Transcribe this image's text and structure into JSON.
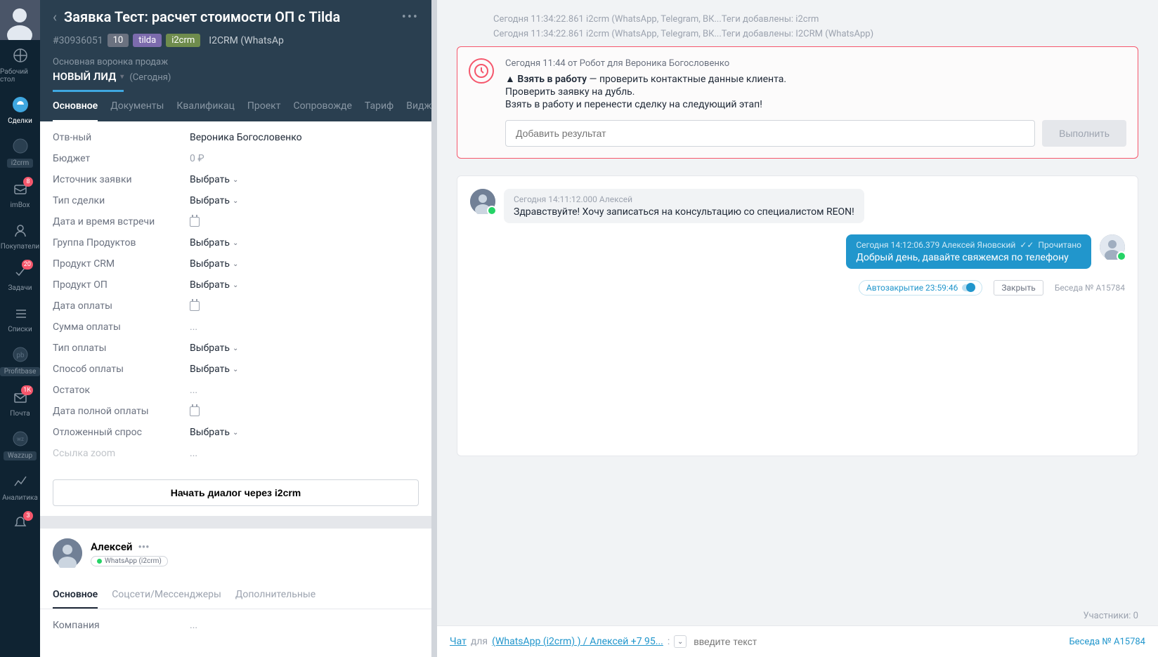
{
  "nav": {
    "items": [
      {
        "label": "Рабочий стол"
      },
      {
        "label": "Сделки"
      },
      {
        "label": "i2crm"
      },
      {
        "label": "imBox",
        "badge": "8"
      },
      {
        "label": "Покупатели"
      },
      {
        "label": "Задачи",
        "badge": "20"
      },
      {
        "label": "Списки"
      },
      {
        "label": "Profitbase"
      },
      {
        "label": "Почта",
        "badge": "1K"
      },
      {
        "label": "Wazzup"
      },
      {
        "label": "Аналитика"
      },
      {
        "label": "",
        "badge": "3"
      }
    ]
  },
  "deal": {
    "title": "Заявка Тест: расчет стоимости ОП с Tilda",
    "id": "#30936051",
    "tags": [
      "10",
      "tilda",
      "i2crm"
    ],
    "source": "I2CRM (WhatsAp",
    "funnel": "Основная воронка продаж",
    "status": "НОВЫЙ ЛИД",
    "status_date": "(Сегодня)"
  },
  "tabs": [
    "Основное",
    "Документы",
    "Квалификац",
    "Проект",
    "Сопровожде",
    "Тариф",
    "Виджеты"
  ],
  "fields": {
    "responsible": {
      "label": "Отв-ный",
      "value": "Вероника Богословенко"
    },
    "budget": {
      "label": "Бюджет",
      "value": "0 ₽"
    },
    "lead_source": {
      "label": "Источник заявки",
      "value": "Выбрать"
    },
    "deal_type": {
      "label": "Тип сделки",
      "value": "Выбрать"
    },
    "meeting_date": {
      "label": "Дата и время встречи"
    },
    "product_group": {
      "label": "Группа Продуктов",
      "value": "Выбрать"
    },
    "product_crm": {
      "label": "Продукт CRM",
      "value": "Выбрать"
    },
    "product_op": {
      "label": "Продукт ОП",
      "value": "Выбрать"
    },
    "payment_date": {
      "label": "Дата оплаты"
    },
    "payment_sum": {
      "label": "Сумма оплаты",
      "value": "..."
    },
    "payment_type": {
      "label": "Тип оплаты",
      "value": "Выбрать"
    },
    "payment_method": {
      "label": "Способ оплаты",
      "value": "Выбрать"
    },
    "balance": {
      "label": "Остаток",
      "value": "..."
    },
    "full_payment_date": {
      "label": "Дата полной оплаты"
    },
    "deferred_demand": {
      "label": "Отложенный спрос",
      "value": "Выбрать"
    },
    "zoom_link": {
      "label": "Ссылка zoom",
      "value": "..."
    }
  },
  "dialog_btn": "Начать диалог через i2crm",
  "contact": {
    "name": "Алексей",
    "channel": "WhatsApp (i2crm)",
    "subtabs": [
      "Основное",
      "Соцсети/Мессенджеры",
      "Дополнительные"
    ],
    "company_label": "Компания",
    "company_value": "..."
  },
  "feed": {
    "log1": "Сегодня 11:34:22.861 i2crm (WhatsApp, Telegram, ВК...Теги добавлены: i2crm",
    "log2": "Сегодня 11:34:22.861 i2crm (WhatsApp, Telegram, ВК...Теги добавлены: I2CRM (WhatsApp)",
    "task": {
      "meta": "Сегодня 11:44 от Робот для Вероника Богословенко",
      "title": "Взять в работу",
      "desc1": "— проверить контактные данные клиента.",
      "desc2": "Проверить заявку на дубль.",
      "desc3": "Взять в работу и перенести сделку на следующий этап!",
      "placeholder": "Добавить результат",
      "button": "Выполнить"
    },
    "messages": {
      "in": {
        "meta": "Сегодня 14:11:12.000 Алексей",
        "text": "Здравствуйте! Хочу записаться на консультацию со специалистом REON!"
      },
      "out": {
        "meta": "Сегодня 14:12:06.379 Алексей Яновский",
        "read": "Прочитано",
        "text": "Добрый день, давайте свяжемся по телефону"
      }
    },
    "chat_footer": {
      "autoclose": "Автозакрытие 23:59:46",
      "close": "Закрыть",
      "conv": "Беседа № A15784"
    }
  },
  "participants": "Участники: 0",
  "input_bar": {
    "chat": "Чат",
    "for": "для",
    "channel": "(WhatsApp (i2crm) ) / Алексей +7 95...",
    "smile": ":",
    "placeholder": "введите текст",
    "conv": "Беседа № A15784"
  }
}
